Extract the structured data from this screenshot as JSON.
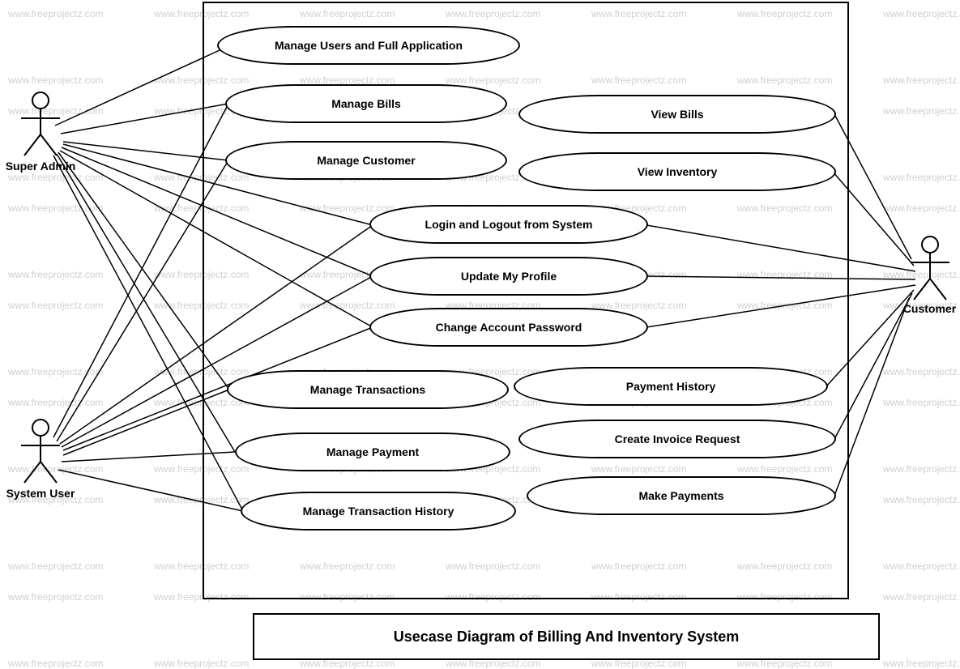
{
  "title": "Usecase Diagram of Billing And Inventory System",
  "watermark_text": "www.freeprojectz.com",
  "actors": {
    "super_admin": "Super Admin",
    "system_user": "System User",
    "customer": "Customer"
  },
  "usecases": {
    "manage_users": "Manage Users and Full Application",
    "manage_bills": "Manage Bills",
    "manage_customer": "Manage Customer",
    "view_bills": "View Bills",
    "view_inventory": "View Inventory",
    "login_logout": "Login and Logout from System",
    "update_profile": "Update My Profile",
    "change_password": "Change Account Password",
    "manage_transactions": "Manage Transactions",
    "payment_history": "Payment History",
    "manage_payment": "Manage Payment",
    "create_invoice": "Create Invoice Request",
    "manage_trans_history": "Manage Transaction History",
    "make_payments": "Make Payments"
  },
  "associations": {
    "super_admin": [
      "manage_users",
      "manage_bills",
      "manage_customer",
      "login_logout",
      "update_profile",
      "change_password",
      "manage_transactions",
      "manage_payment",
      "manage_trans_history"
    ],
    "system_user": [
      "manage_bills",
      "manage_customer",
      "login_logout",
      "update_profile",
      "change_password",
      "manage_transactions",
      "manage_payment",
      "manage_trans_history"
    ],
    "customer": [
      "view_bills",
      "view_inventory",
      "login_logout",
      "update_profile",
      "change_password",
      "payment_history",
      "create_invoice",
      "make_payments"
    ]
  }
}
